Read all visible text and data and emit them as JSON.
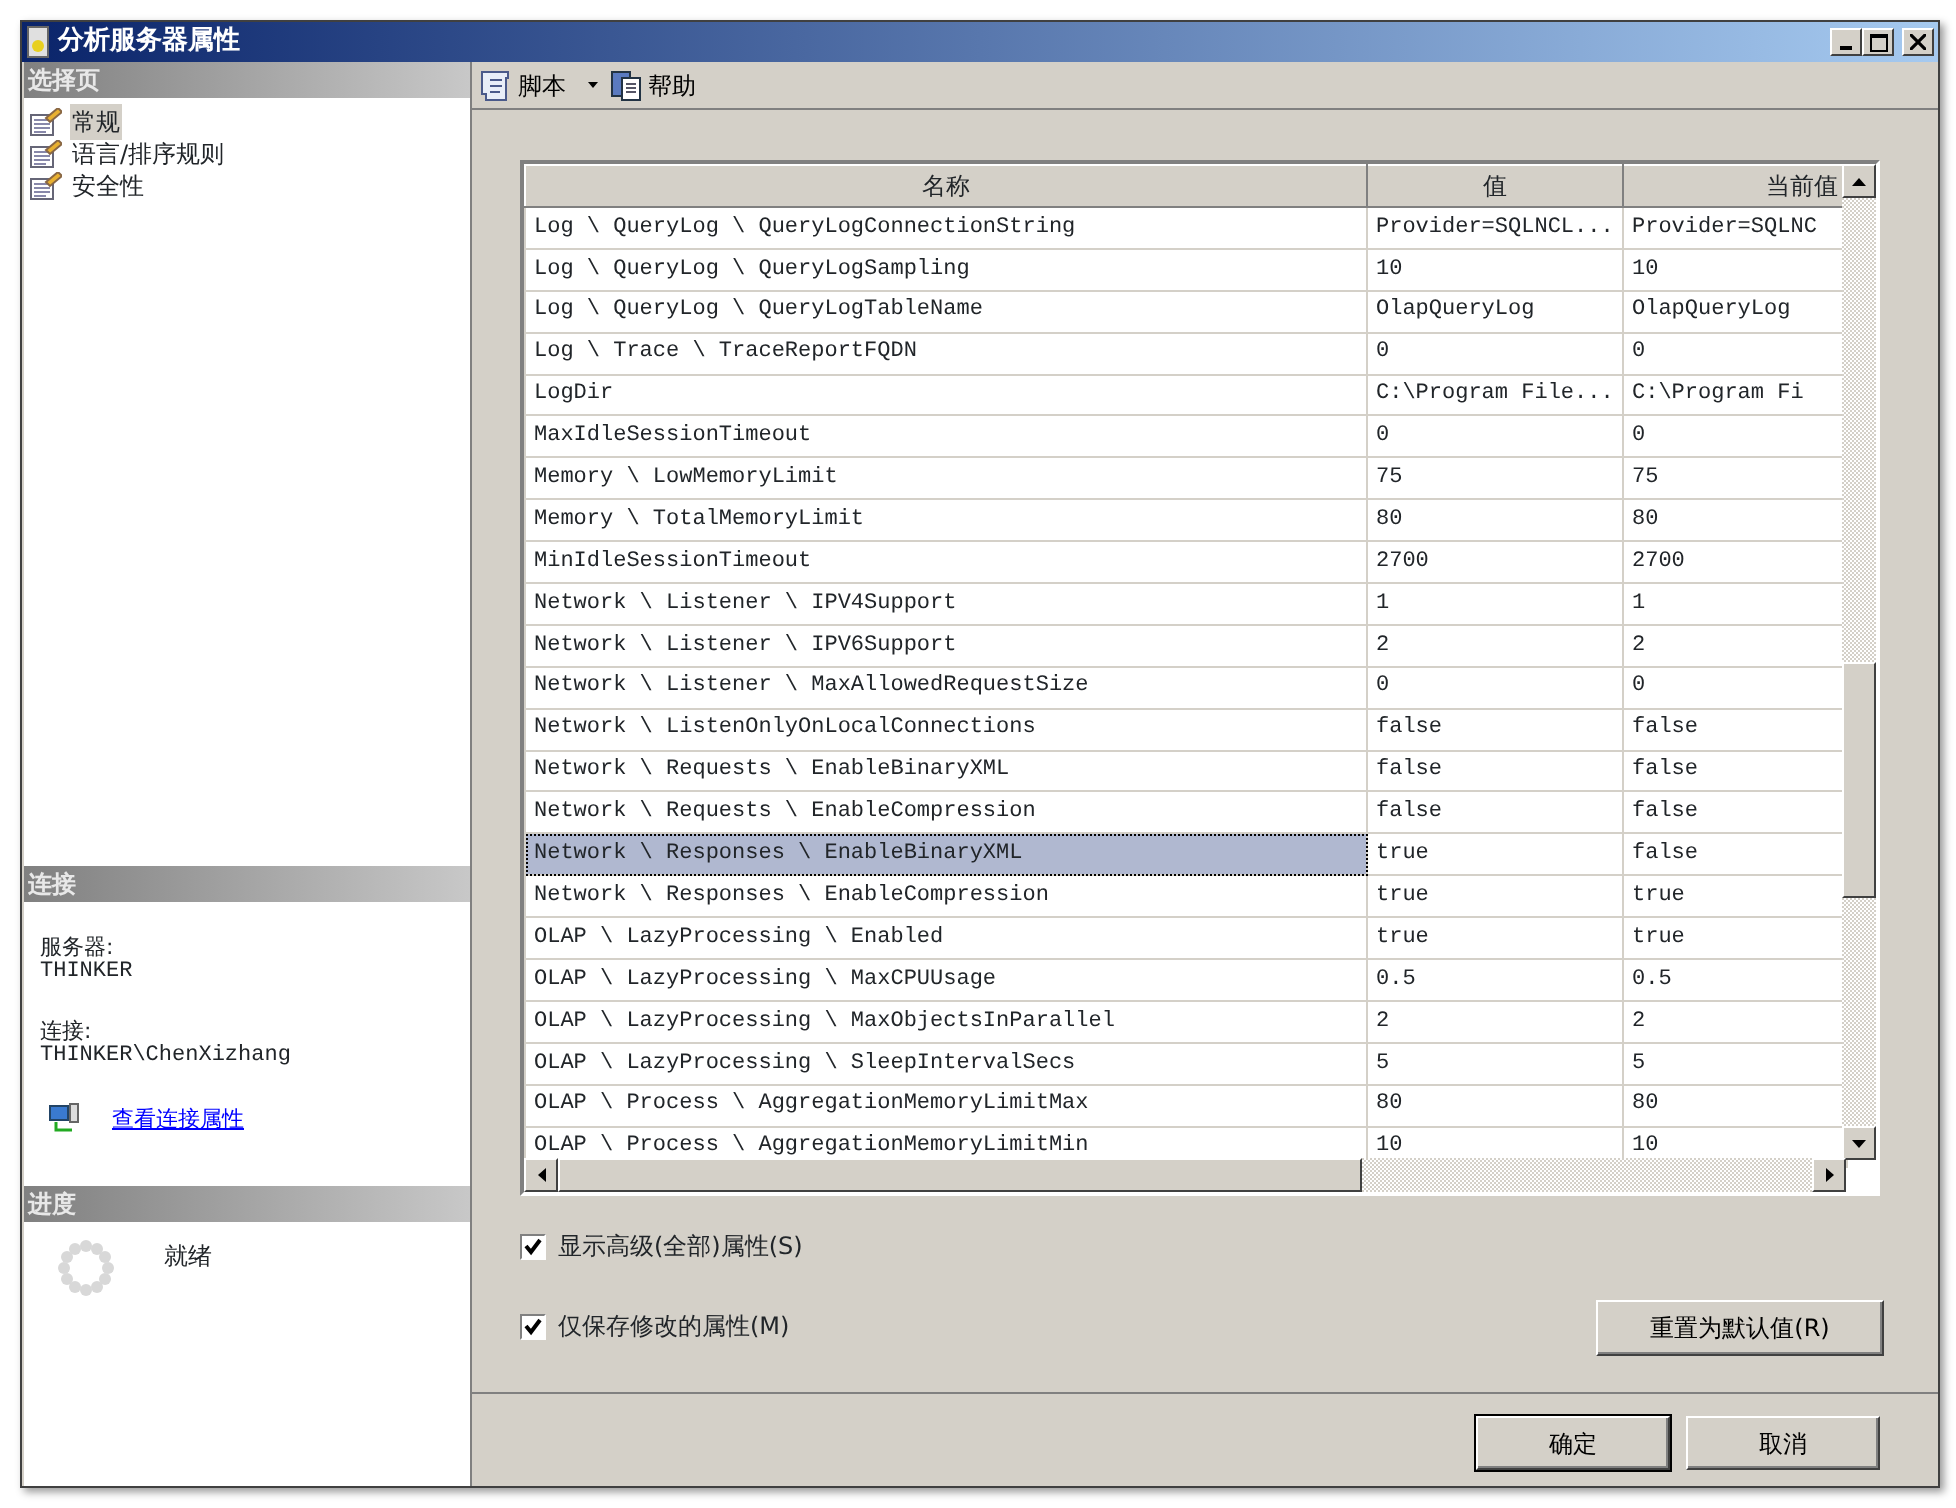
{
  "window": {
    "title": "分析服务器属性"
  },
  "sidebar": {
    "heading": "选择页",
    "items": [
      {
        "label": "常规",
        "selected": true
      },
      {
        "label": "语言/排序规则",
        "selected": false
      },
      {
        "label": "安全性",
        "selected": false
      }
    ]
  },
  "connection": {
    "heading": "连接",
    "server_label": "服务器:",
    "server": "THINKER",
    "connection_label": "连接:",
    "connection": "THINKER\\ChenXizhang",
    "link": "查看连接属性"
  },
  "progress": {
    "heading": "进度",
    "status": "就绪"
  },
  "toolbar": [
    {
      "label": "脚本",
      "kind": "dropdown"
    },
    {
      "label": "帮助",
      "kind": "help"
    }
  ],
  "table": {
    "columns": [
      "名称",
      "值",
      "当前值"
    ],
    "rows": [
      {
        "cells": [
          "Log \\ QueryLog \\ QueryLogConnectionString",
          "Provider=SQLNCL...",
          "Provider=SQLNC"
        ],
        "selected": false
      },
      {
        "cells": [
          "Log \\ QueryLog \\ QueryLogSampling",
          "10",
          "10"
        ],
        "selected": false
      },
      {
        "cells": [
          "Log \\ QueryLog \\ QueryLogTableName",
          "OlapQueryLog",
          "OlapQueryLog"
        ],
        "selected": false
      },
      {
        "cells": [
          "Log \\ Trace \\ TraceReportFQDN",
          "0",
          "0"
        ],
        "selected": false
      },
      {
        "cells": [
          "LogDir",
          "C:\\Program File...",
          "C:\\Program Fi"
        ],
        "selected": false
      },
      {
        "cells": [
          "MaxIdleSessionTimeout",
          "0",
          "0"
        ],
        "selected": false
      },
      {
        "cells": [
          "Memory \\ LowMemoryLimit",
          "75",
          "75"
        ],
        "selected": false
      },
      {
        "cells": [
          "Memory \\ TotalMemoryLimit",
          "80",
          "80"
        ],
        "selected": false
      },
      {
        "cells": [
          "MinIdleSessionTimeout",
          "2700",
          "2700"
        ],
        "selected": false
      },
      {
        "cells": [
          "Network \\ Listener \\ IPV4Support",
          "1",
          "1"
        ],
        "selected": false
      },
      {
        "cells": [
          "Network \\ Listener \\ IPV6Support",
          "2",
          "2"
        ],
        "selected": false
      },
      {
        "cells": [
          "Network \\ Listener \\ MaxAllowedRequestSize",
          "0",
          "0"
        ],
        "selected": false
      },
      {
        "cells": [
          "Network \\ ListenOnlyOnLocalConnections",
          "false",
          "false"
        ],
        "selected": false
      },
      {
        "cells": [
          "Network \\ Requests \\ EnableBinaryXML",
          "false",
          "false"
        ],
        "selected": false
      },
      {
        "cells": [
          "Network \\ Requests \\ EnableCompression",
          "false",
          "false"
        ],
        "selected": false
      },
      {
        "cells": [
          "Network \\ Responses \\ EnableBinaryXML",
          "true",
          "false"
        ],
        "selected": true
      },
      {
        "cells": [
          "Network \\ Responses \\ EnableCompression",
          "true",
          "true"
        ],
        "selected": false
      },
      {
        "cells": [
          "OLAP \\ LazyProcessing \\ Enabled",
          "true",
          "true"
        ],
        "selected": false
      },
      {
        "cells": [
          "OLAP \\ LazyProcessing \\ MaxCPUUsage",
          "0.5",
          "0.5"
        ],
        "selected": false
      },
      {
        "cells": [
          "OLAP \\ LazyProcessing \\ MaxObjectsInParallel",
          "2",
          "2"
        ],
        "selected": false
      },
      {
        "cells": [
          "OLAP \\ LazyProcessing \\ SleepIntervalSecs",
          "5",
          "5"
        ],
        "selected": false
      },
      {
        "cells": [
          "OLAP \\ Process \\ AggregationMemoryLimitMax",
          "80",
          "80"
        ],
        "selected": false
      },
      {
        "cells": [
          "OLAP \\ Process \\ AggregationMemoryLimitMin",
          "10",
          "10"
        ],
        "selected": false
      }
    ]
  },
  "options": [
    {
      "label": "显示高级(全部)属性(S)",
      "checked": true
    },
    {
      "label": "仅保存修改的属性(M)",
      "checked": true
    }
  ],
  "reset_button": "重置为默认值(R)",
  "buttons": [
    "确定",
    "取消"
  ]
}
